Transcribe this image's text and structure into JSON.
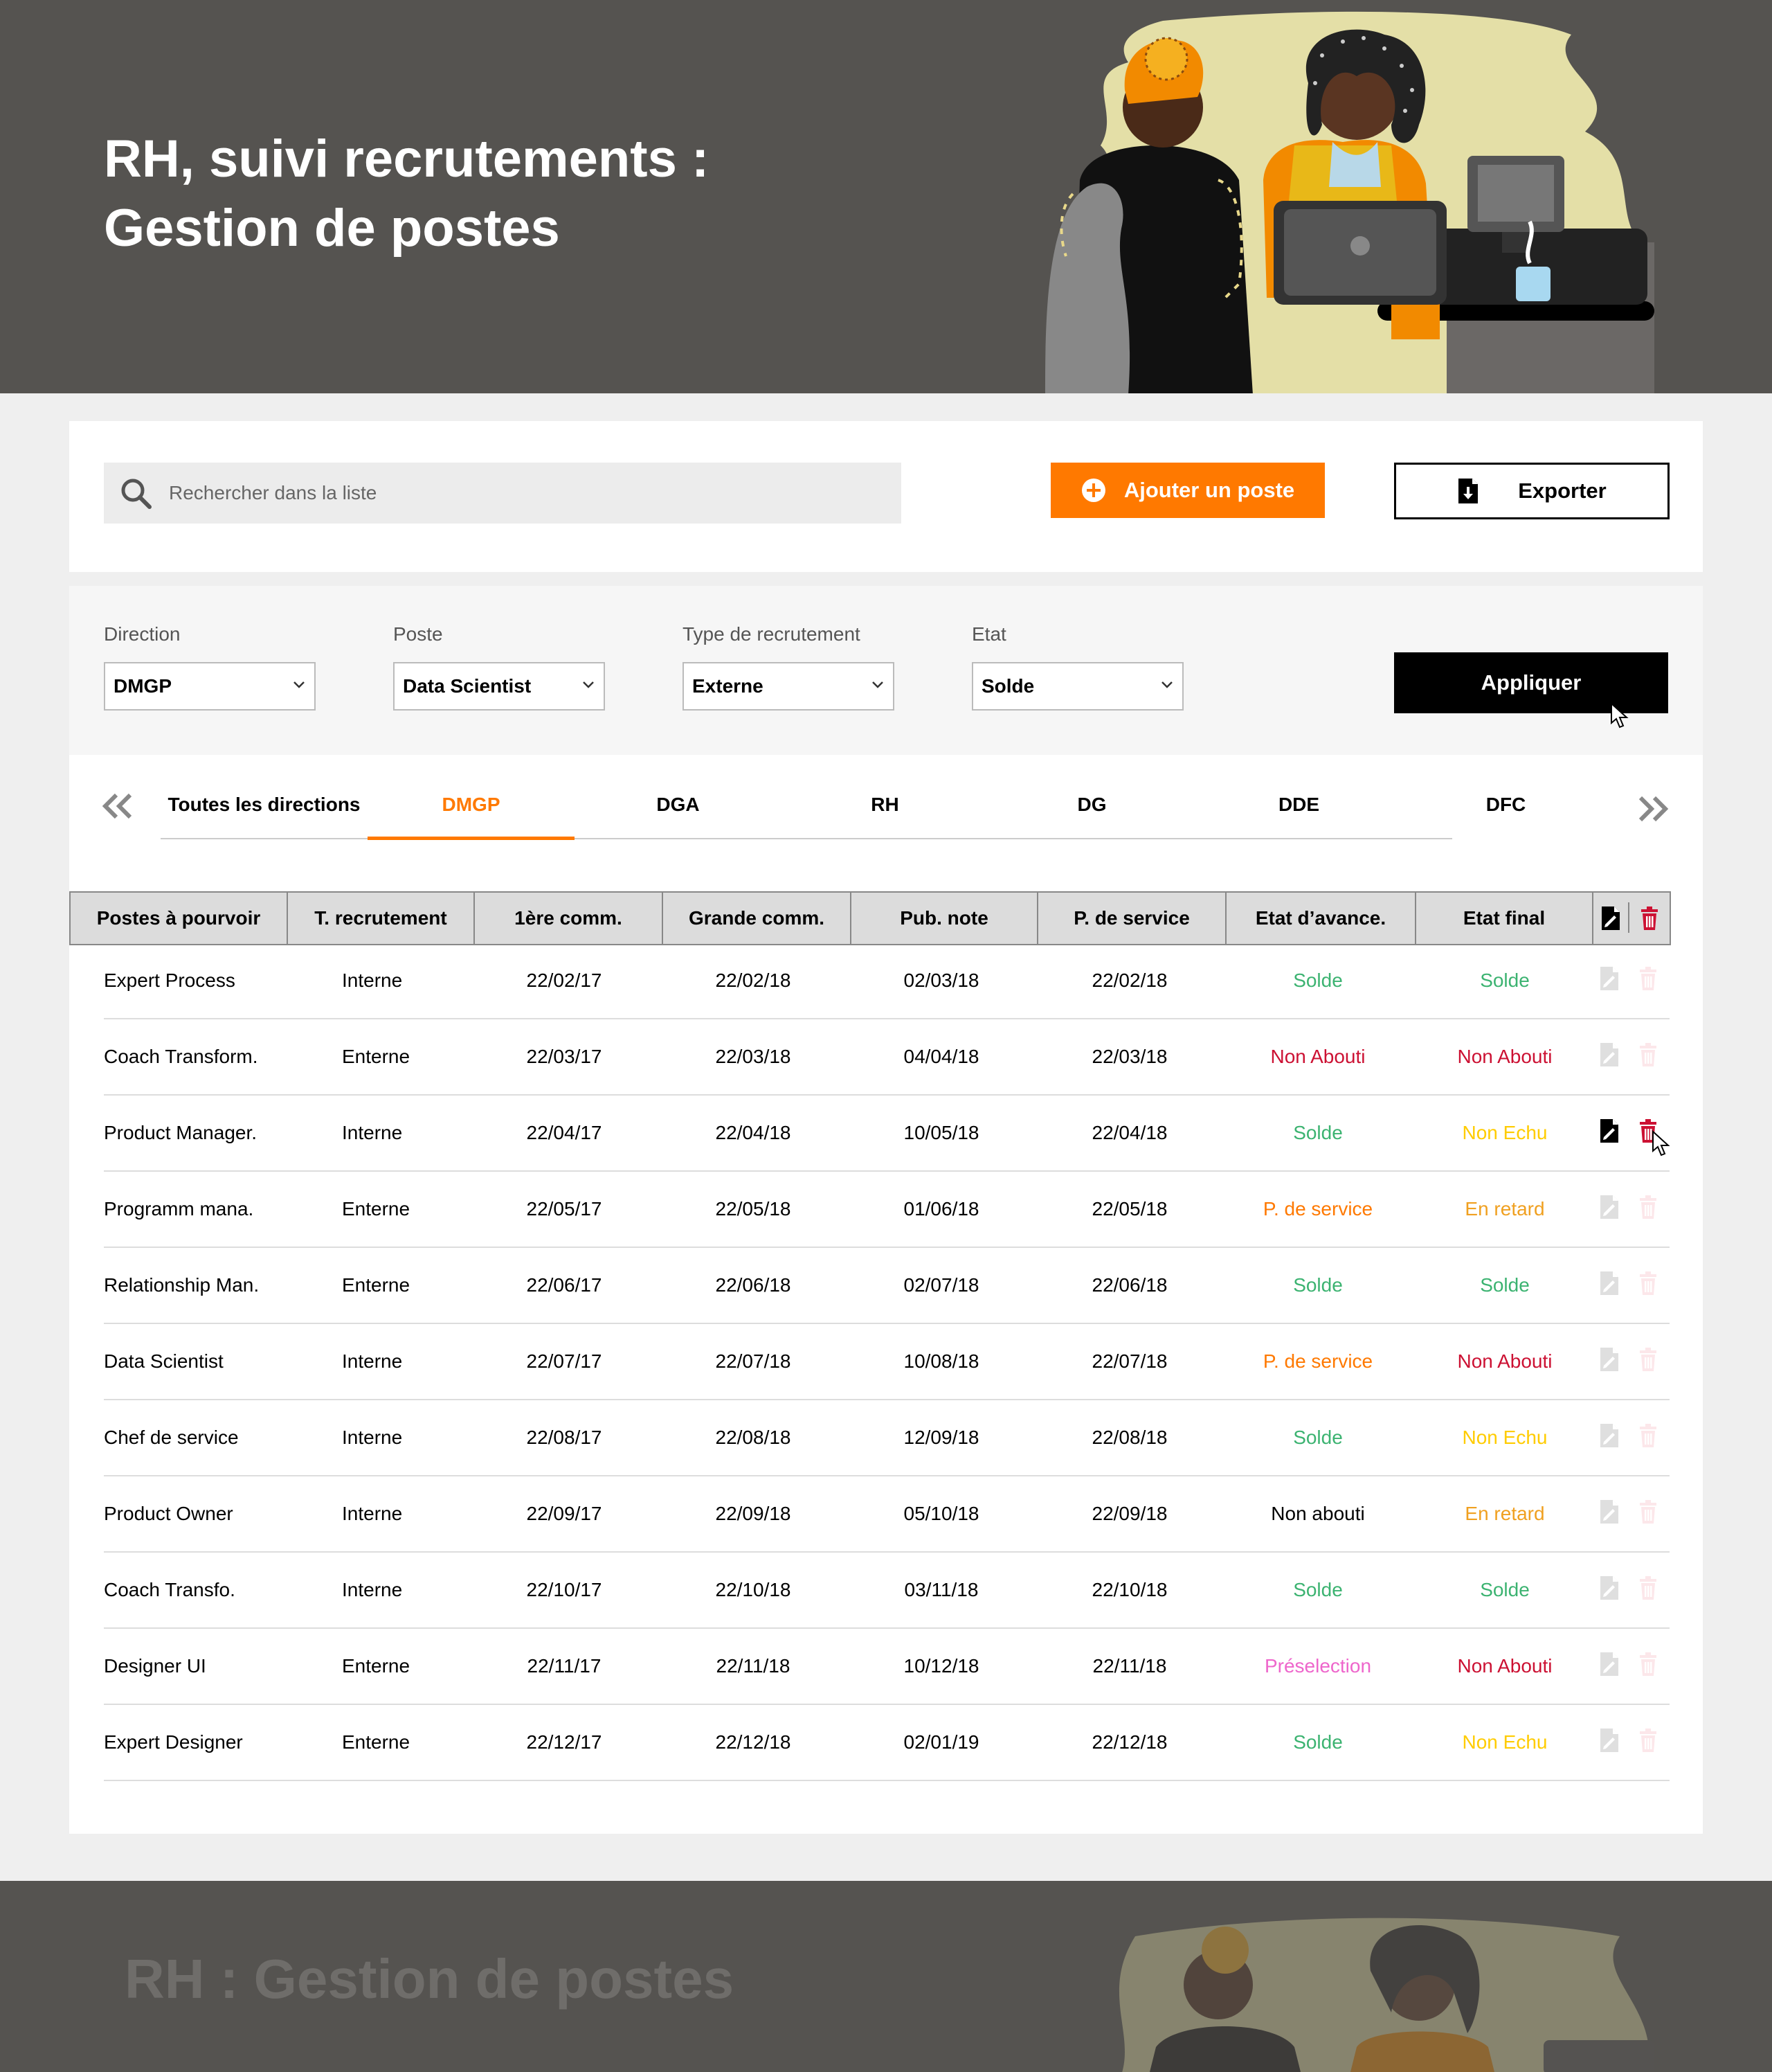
{
  "header": {
    "title": "RH, suivi recrutements :\nGestion de postes"
  },
  "search": {
    "placeholder": "Rechercher dans la liste"
  },
  "toolbar": {
    "add_label": "Ajouter un poste",
    "export_label": "Exporter"
  },
  "filters": [
    {
      "label": "Direction",
      "value": "DMGP"
    },
    {
      "label": "Poste",
      "value": "Data Scientist"
    },
    {
      "label": "Type de recrutement",
      "value": "Externe"
    },
    {
      "label": "Etat",
      "value": "Solde"
    }
  ],
  "apply_label": "Appliquer",
  "tabs": [
    {
      "label": "Toutes les directions",
      "active": false
    },
    {
      "label": "DMGP",
      "active": true
    },
    {
      "label": "DGA",
      "active": false
    },
    {
      "label": "RH",
      "active": false
    },
    {
      "label": "DG",
      "active": false
    },
    {
      "label": "DDE",
      "active": false
    },
    {
      "label": "DFC",
      "active": false
    }
  ],
  "table": {
    "headers": [
      "Postes à pourvoir",
      "T. recrutement",
      "1ère comm.",
      "Grande comm.",
      "Pub. note",
      "P. de service",
      "Etat d’avance.",
      "Etat final"
    ],
    "rows": [
      [
        "Expert Process",
        "Interne",
        "22/02/17",
        "22/02/18",
        "02/03/18",
        "22/02/18",
        "Solde",
        "Solde"
      ],
      [
        "Coach Transform.",
        "Enterne",
        "22/03/17",
        "22/03/18",
        "04/04/18",
        "22/03/18",
        "Non Abouti",
        "Non Abouti"
      ],
      [
        "Product Manager.",
        "Interne",
        "22/04/17",
        "22/04/18",
        "10/05/18",
        "22/04/18",
        "Solde",
        "Non Echu"
      ],
      [
        "Programm mana.",
        "Enterne",
        "22/05/17",
        "22/05/18",
        "01/06/18",
        "22/05/18",
        "P. de service",
        "En retard"
      ],
      [
        "Relationship Man.",
        "Enterne",
        "22/06/17",
        "22/06/18",
        "02/07/18",
        "22/06/18",
        "Solde",
        "Solde"
      ],
      [
        "Data Scientist",
        "Interne",
        "22/07/17",
        "22/07/18",
        "10/08/18",
        "22/07/18",
        "P. de service",
        "Non Abouti"
      ],
      [
        "Chef de service",
        "Interne",
        "22/08/17",
        "22/08/18",
        "12/09/18",
        "22/08/18",
        "Solde",
        "Non Echu"
      ],
      [
        "Product Owner",
        "Interne",
        "22/09/17",
        "22/09/18",
        "05/10/18",
        "22/09/18",
        "Non abouti",
        "En retard"
      ],
      [
        "Coach Transfo.",
        "Interne",
        "22/10/17",
        "22/10/18",
        "03/11/18",
        "22/10/18",
        "Solde",
        "Solde"
      ],
      [
        "Designer UI",
        "Enterne",
        "22/11/17",
        "22/11/18",
        "10/12/18",
        "22/11/18",
        "Préselection",
        "Non Abouti"
      ],
      [
        "Expert Designer",
        "Enterne",
        "22/12/17",
        "22/12/18",
        "02/01/19",
        "22/12/18",
        "Solde",
        "Non Echu"
      ]
    ],
    "active_row": 2
  },
  "status_colors": {
    "Solde": "#3cb371",
    "Non Abouti": "#cc1133",
    "Non Echu": "#ffcc00",
    "En retard": "#f0a020",
    "P. de service": "#ff7900",
    "Préselection": "#ee66cc",
    "Non abouti": "#000000",
    "default": "#000000"
  },
  "icons": {
    "edit": "edit-document-icon",
    "delete": "trash-icon",
    "search": "search-icon",
    "add": "plus-circle-icon",
    "export": "download-file-icon"
  },
  "footer": {
    "title": "RH : Gestion de postes"
  }
}
